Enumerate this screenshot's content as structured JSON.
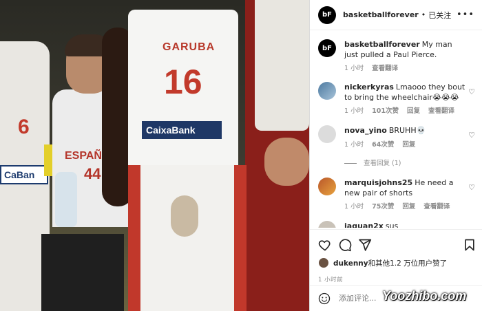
{
  "post": {
    "username": "basketballforever",
    "follow_status": "已关注",
    "avatar_text": "bF",
    "caption_user": "basketballforever",
    "caption_text": "My man just pulled a Paul Pierce.",
    "caption_time": "1 小时",
    "caption_translate": "查看翻译"
  },
  "photo": {
    "left_player_number": "6",
    "left_sponsor": "CaBan",
    "seated_text": "ESPAÑ",
    "seated_number": "44",
    "center_name": "GARUBA",
    "center_number": "16",
    "center_sponsor": "CaixaBank"
  },
  "comments": [
    {
      "user": "nickerkyras",
      "text": "Lmaooo they bout to bring the wheelchair😭😭😭",
      "time": "1 小时",
      "likes": "101次赞",
      "reply": "回复",
      "translate": "查看翻译"
    },
    {
      "user": "nova_yino",
      "text": "BRUHH💀",
      "time": "1 小时",
      "likes": "64次赞",
      "reply": "回复",
      "view_replies": "查看回复 (1)"
    },
    {
      "user": "marquisjohns25",
      "text": "He need a new pair of shorts",
      "time": "1 小时",
      "likes": "75次赞",
      "reply": "回复",
      "translate": "查看翻译"
    },
    {
      "user": "jaquan2x",
      "text": "sus"
    }
  ],
  "likes_summary": {
    "user": "dukenny",
    "rest": "和其他1.2 万位用户赞了"
  },
  "time_ago": "1 小时前",
  "add_comment_placeholder": "添加评论...",
  "watermark": "Yoozhibo.com",
  "icons": [
    "heart-icon",
    "comment-icon",
    "share-icon",
    "bookmark-icon",
    "more-icon",
    "emoji-icon"
  ]
}
